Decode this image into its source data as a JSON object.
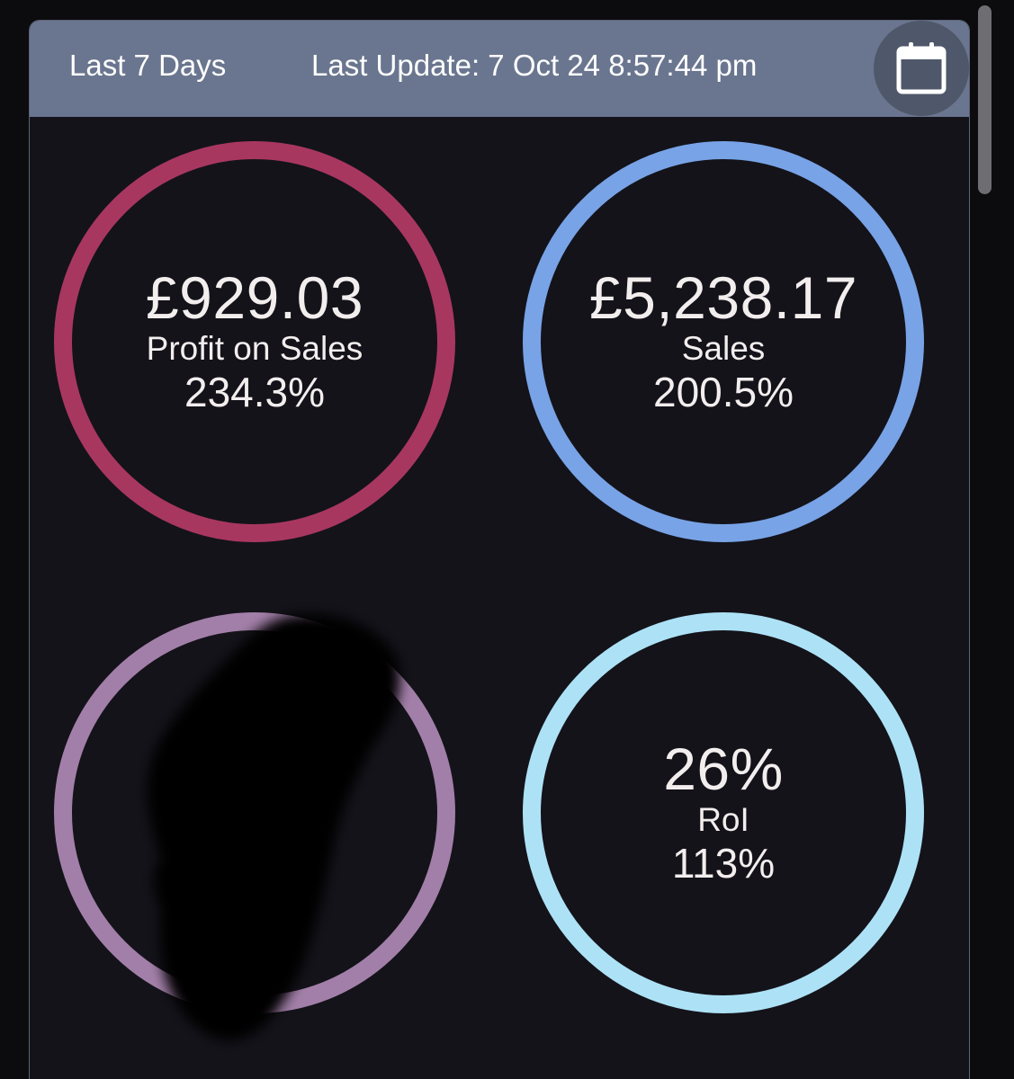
{
  "header": {
    "period": "Last 7 Days",
    "last_update": "Last Update: 7 Oct 24 8:57:44 pm"
  },
  "metrics": [
    {
      "value": "£929.03",
      "label": "Profit on Sales",
      "change": "234.3%",
      "color": "#a83760"
    },
    {
      "value": "£5,238.17",
      "label": "Sales",
      "change": "200.5%",
      "color": "#78a3e6"
    },
    {
      "value": "",
      "label": "",
      "change": "",
      "color": "#a27fa8"
    },
    {
      "value": "26%",
      "label": "RoI",
      "change": "113%",
      "color": "#ade2f6"
    }
  ],
  "icons": {
    "calendar": "calendar-icon"
  },
  "colors": {
    "header_bg": "#6a768f",
    "panel_bg": "#14131a",
    "text": "#f3eeee"
  }
}
